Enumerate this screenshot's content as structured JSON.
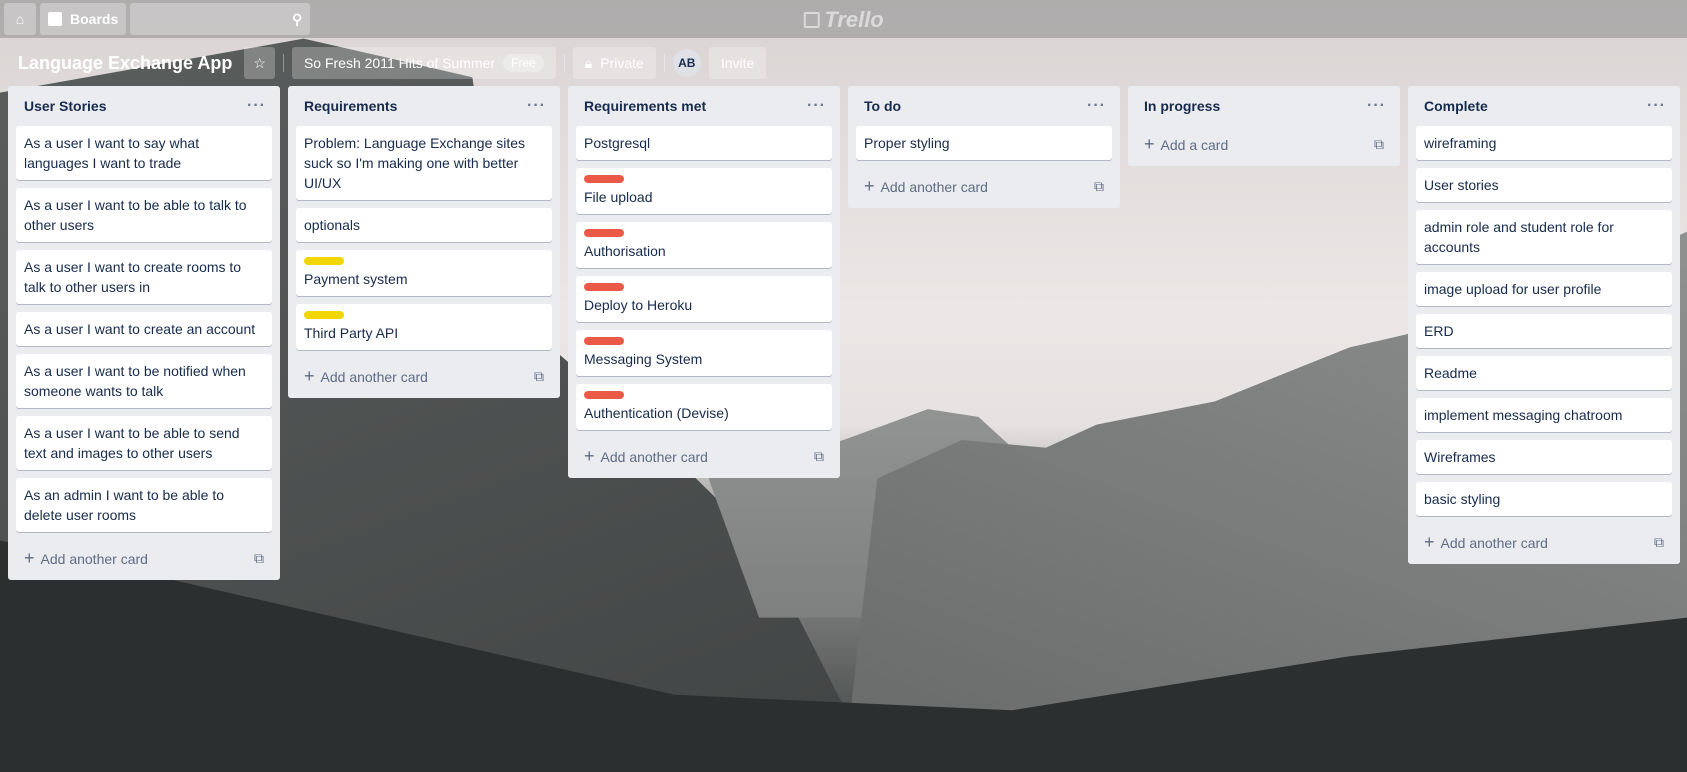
{
  "topbar": {
    "boards_label": "Boards",
    "logo": "Trello"
  },
  "board": {
    "title": "Language Exchange App",
    "team": "So Fresh 2011 Hits of Summer",
    "team_badge": "Free",
    "visibility": "Private",
    "avatar": "AB",
    "invite": "Invite"
  },
  "colors": {
    "yellow": "#f2d600",
    "red": "#eb5a46"
  },
  "add_another": "Add another card",
  "add_card": "Add a card",
  "lists": [
    {
      "title": "User Stories",
      "cards": [
        {
          "text": "As a user I want to say what languages I want to trade"
        },
        {
          "text": "As a user I want to be able to talk to other users"
        },
        {
          "text": "As a user I want to create rooms to talk to other users in"
        },
        {
          "text": "As a user I want to create an account"
        },
        {
          "text": "As a user I want to be notified when someone wants to talk"
        },
        {
          "text": "As a user I want to be able to send text and images to other users"
        },
        {
          "text": "As an admin I want to be able to delete user rooms"
        }
      ]
    },
    {
      "title": "Requirements",
      "cards": [
        {
          "text": "Problem: Language Exchange sites suck so I'm making one with better UI/UX"
        },
        {
          "text": "optionals"
        },
        {
          "text": "Payment system",
          "label": "yellow"
        },
        {
          "text": "Third Party API",
          "label": "yellow"
        }
      ]
    },
    {
      "title": "Requirements met",
      "cards": [
        {
          "text": "Postgresql"
        },
        {
          "text": "File upload",
          "label": "red"
        },
        {
          "text": "Authorisation",
          "label": "red"
        },
        {
          "text": "Deploy to Heroku",
          "label": "red"
        },
        {
          "text": "Messaging System",
          "label": "red"
        },
        {
          "text": "Authentication (Devise)",
          "label": "red"
        }
      ]
    },
    {
      "title": "To do",
      "cards": [
        {
          "text": "Proper styling"
        }
      ]
    },
    {
      "title": "In progress",
      "cards": [],
      "empty": true
    },
    {
      "title": "Complete",
      "cards": [
        {
          "text": "wireframing"
        },
        {
          "text": "User stories"
        },
        {
          "text": "admin role and student role for accounts"
        },
        {
          "text": "image upload for user profile"
        },
        {
          "text": "ERD"
        },
        {
          "text": "Readme"
        },
        {
          "text": "implement messaging chatroom"
        },
        {
          "text": "Wireframes"
        },
        {
          "text": "basic styling"
        }
      ]
    }
  ]
}
